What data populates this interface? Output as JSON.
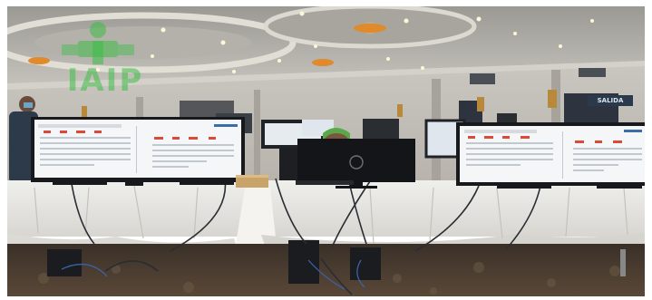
{
  "logo": {
    "text": "IAIP"
  },
  "exit_sign": {
    "text": "SALIDA"
  }
}
